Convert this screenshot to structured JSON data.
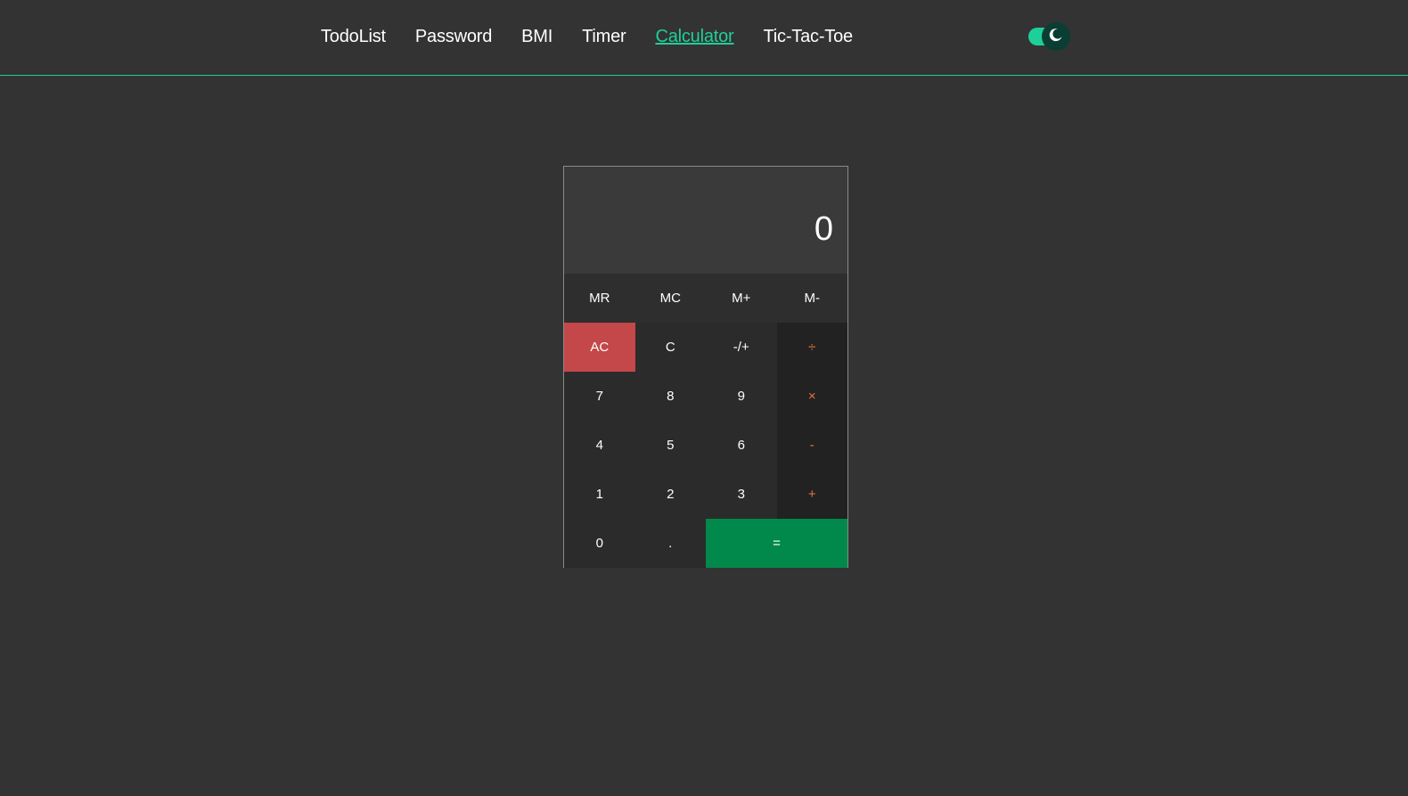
{
  "nav": {
    "links": [
      {
        "label": "TodoList"
      },
      {
        "label": "Password"
      },
      {
        "label": "BMI"
      },
      {
        "label": "Timer"
      },
      {
        "label": "Calculator"
      },
      {
        "label": "Tic-Tac-Toe"
      }
    ],
    "active": "Calculator"
  },
  "theme_toggle": {
    "icon": "moon-icon",
    "state": "dark"
  },
  "calculator": {
    "display": "0",
    "memory_keys": [
      "MR",
      "MC",
      "M+",
      "M-"
    ],
    "rows": [
      [
        "AC",
        "C",
        "-/+",
        "÷"
      ],
      [
        "7",
        "8",
        "9",
        "×"
      ],
      [
        "4",
        "5",
        "6",
        "-"
      ],
      [
        "1",
        "2",
        "3",
        "+"
      ]
    ],
    "last_row": [
      "0",
      ".",
      "="
    ]
  },
  "colors": {
    "accent": "#1fcf9a",
    "background": "#333333",
    "operator": "#e8733d",
    "clear_all": "#c4474a",
    "equals": "#00894a"
  }
}
